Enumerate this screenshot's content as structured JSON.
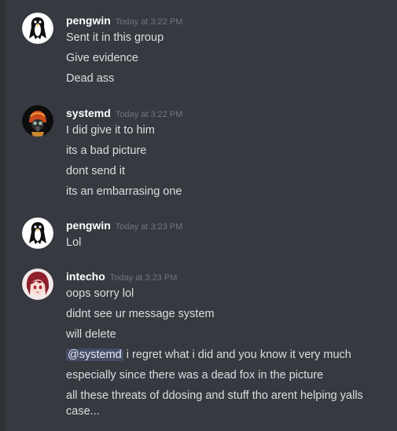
{
  "messages": [
    {
      "username": "pengwin",
      "timestamp": "Today at 3:22 PM",
      "avatar_icon": "penguin-avatar-icon",
      "lines": [
        "Sent it in this group",
        "Give evidence",
        "Dead ass"
      ]
    },
    {
      "username": "systemd",
      "timestamp": "Today at 3:22 PM",
      "avatar_icon": "gasmask-avatar-icon",
      "lines": [
        "I did give it to him",
        "its a bad picture",
        "dont send it",
        "its an embarrasing one"
      ]
    },
    {
      "username": "pengwin",
      "timestamp": "Today at 3:23 PM",
      "avatar_icon": "penguin-avatar-icon",
      "lines": [
        "Lol"
      ]
    },
    {
      "username": "intecho",
      "timestamp": "Today at 3:23 PM",
      "avatar_icon": "anime-avatar-icon",
      "lines": [
        "oops sorry lol",
        "didnt see ur message system",
        "will delete"
      ],
      "mention_line": {
        "mention": "@systemd",
        "text": " i regret what i did and you know it very much"
      },
      "lines_after": [
        "especially since there was a dead fox in the picture",
        "all these threats of ddosing and stuff tho arent helping yalls case..."
      ]
    }
  ],
  "colors": {
    "background": "#36393f",
    "username": "#ffffff",
    "timestamp": "#72767d",
    "text": "#dcddde",
    "mention_bg": "#4a5170"
  }
}
